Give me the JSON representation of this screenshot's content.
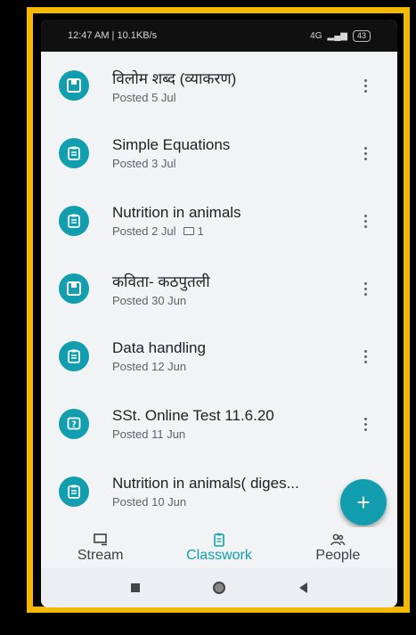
{
  "status_bar": {
    "time_info": "12:47 AM | 10.1KB/s",
    "network": "4G",
    "battery": "43"
  },
  "classwork": {
    "items": [
      {
        "title": "विलोम शब्द (व्याकरण)",
        "posted": "Posted 5 Jul",
        "icon": "material-icon",
        "comments": ""
      },
      {
        "title": "Simple Equations",
        "posted": "Posted 3 Jul",
        "icon": "assignment-icon",
        "comments": ""
      },
      {
        "title": "Nutrition in animals",
        "posted": "Posted 2 Jul",
        "icon": "assignment-icon",
        "comments": "1"
      },
      {
        "title": "कविता- कठपुतली",
        "posted": "Posted 30 Jun",
        "icon": "material-icon",
        "comments": ""
      },
      {
        "title": "Data handling",
        "posted": "Posted 12 Jun",
        "icon": "assignment-icon",
        "comments": ""
      },
      {
        "title": "SSt. Online Test 11.6.20",
        "posted": "Posted 11 Jun",
        "icon": "question-icon",
        "comments": ""
      },
      {
        "title": "Nutrition in animals( diges...",
        "posted": "Posted 10 Jun",
        "icon": "assignment-icon",
        "comments": ""
      }
    ]
  },
  "fab": {
    "label": "+"
  },
  "bottom_nav": {
    "stream": "Stream",
    "classwork": "Classwork",
    "people": "People"
  },
  "colors": {
    "accent": "#129eaf",
    "frame": "#f5b800"
  }
}
